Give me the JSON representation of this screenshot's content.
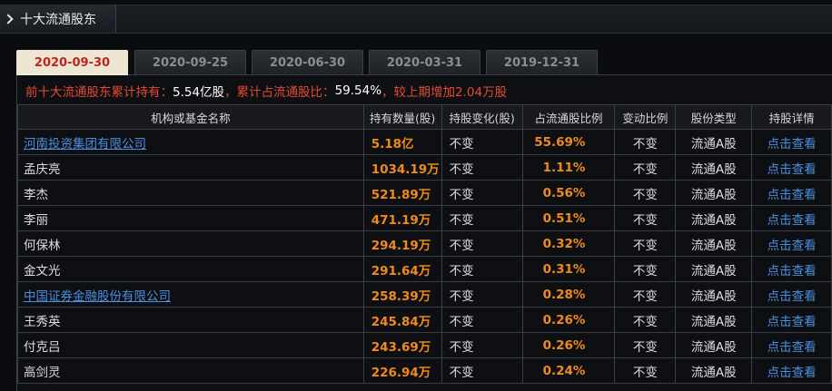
{
  "header": {
    "title": "十大流通股东"
  },
  "tabs": [
    "2020-09-30",
    "2020-09-25",
    "2020-06-30",
    "2020-03-31",
    "2019-12-31"
  ],
  "active_tab": 0,
  "summary": {
    "part1": "前十大流通股东累计持有：",
    "holding": "5.54亿股",
    "part2": "，累计占流通股比：",
    "ratio": "59.54%",
    "part3": "，较上期增加",
    "increase": "2.04万股"
  },
  "columns": [
    "机构或基金名称",
    "持有数量(股)",
    "持股变化(股)",
    "占流通股比例",
    "变动比例",
    "股份类型",
    "持股详情"
  ],
  "rows": [
    {
      "name": "河南投资集团有限公司",
      "link": true,
      "qty": "5.18亿",
      "change": "不变",
      "pct": "55.69%",
      "ratio_change": "不变",
      "type": "流通A股",
      "detail": "点击查看"
    },
    {
      "name": "孟庆亮",
      "link": false,
      "qty": "1034.19万",
      "change": "不变",
      "pct": "1.11%",
      "ratio_change": "不变",
      "type": "流通A股",
      "detail": "点击查看"
    },
    {
      "name": "李杰",
      "link": false,
      "qty": "521.89万",
      "change": "不变",
      "pct": "0.56%",
      "ratio_change": "不变",
      "type": "流通A股",
      "detail": "点击查看"
    },
    {
      "name": "李丽",
      "link": false,
      "qty": "471.19万",
      "change": "不变",
      "pct": "0.51%",
      "ratio_change": "不变",
      "type": "流通A股",
      "detail": "点击查看"
    },
    {
      "name": "何保林",
      "link": false,
      "qty": "294.19万",
      "change": "不变",
      "pct": "0.32%",
      "ratio_change": "不变",
      "type": "流通A股",
      "detail": "点击查看"
    },
    {
      "name": "金文光",
      "link": false,
      "qty": "291.64万",
      "change": "不变",
      "pct": "0.31%",
      "ratio_change": "不变",
      "type": "流通A股",
      "detail": "点击查看"
    },
    {
      "name": "中国证券金融股份有限公司",
      "link": true,
      "qty": "258.39万",
      "change": "不变",
      "pct": "0.28%",
      "ratio_change": "不变",
      "type": "流通A股",
      "detail": "点击查看"
    },
    {
      "name": "王秀英",
      "link": false,
      "qty": "245.84万",
      "change": "不变",
      "pct": "0.26%",
      "ratio_change": "不变",
      "type": "流通A股",
      "detail": "点击查看"
    },
    {
      "name": "付克吕",
      "link": false,
      "qty": "243.69万",
      "change": "不变",
      "pct": "0.26%",
      "ratio_change": "不变",
      "type": "流通A股",
      "detail": "点击查看"
    },
    {
      "name": "高剑灵",
      "link": false,
      "qty": "226.94万",
      "change": "不变",
      "pct": "0.24%",
      "ratio_change": "不变",
      "type": "流通A股",
      "detail": "点击查看"
    }
  ]
}
